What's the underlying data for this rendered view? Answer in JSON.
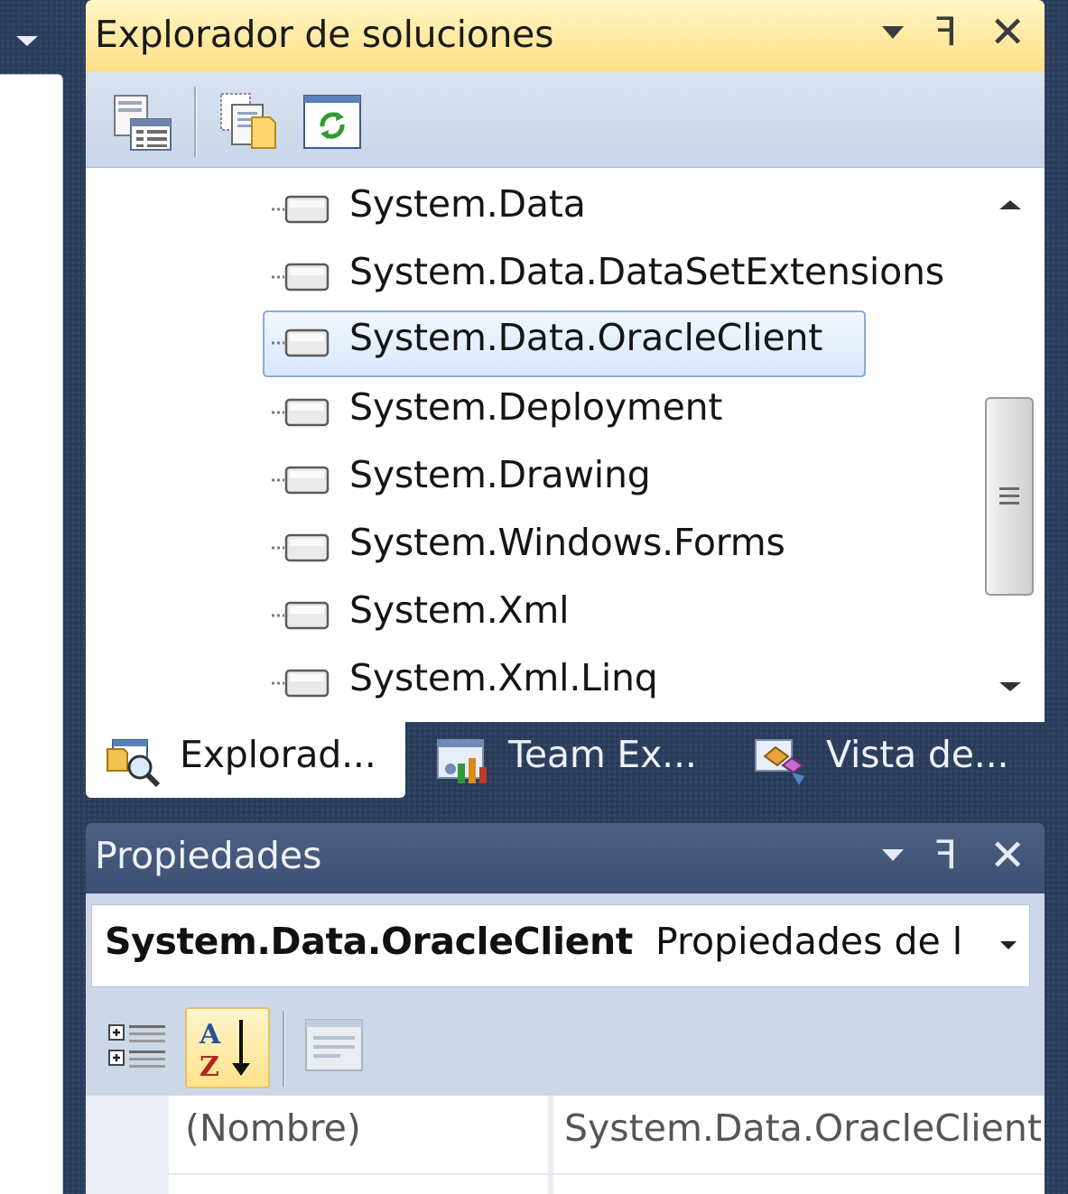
{
  "solution_explorer": {
    "title": "Explorador de soluciones",
    "controls": {
      "dropdown": "▾",
      "pin": "ꟻ",
      "close": "✕"
    },
    "toolbar": [
      {
        "name": "properties-icon"
      },
      {
        "name": "show-all-files-icon"
      },
      {
        "name": "refresh-icon"
      }
    ],
    "references": [
      {
        "label": "System.Data",
        "selected": false
      },
      {
        "label": "System.Data.DataSetExtensions",
        "selected": false
      },
      {
        "label": "System.Data.OracleClient",
        "selected": true
      },
      {
        "label": "System.Deployment",
        "selected": false
      },
      {
        "label": "System.Drawing",
        "selected": false
      },
      {
        "label": "System.Windows.Forms",
        "selected": false
      },
      {
        "label": "System.Xml",
        "selected": false
      },
      {
        "label": "System.Xml.Linq",
        "selected": false
      }
    ],
    "tabs": [
      {
        "label": "Explorad...",
        "icon": "solution-explorer-icon",
        "active": true
      },
      {
        "label": "Team Ex...",
        "icon": "team-explorer-icon",
        "active": false
      },
      {
        "label": "Vista de...",
        "icon": "class-view-icon",
        "active": false
      }
    ]
  },
  "properties": {
    "title": "Propiedades",
    "controls": {
      "pin": "ꟻ",
      "close": "✕"
    },
    "object_name": "System.Data.OracleClient",
    "object_type": "Propiedades de l",
    "grid": [
      {
        "name": "(Nombre)",
        "value": "System.Data.OracleClient"
      }
    ]
  },
  "colors": {
    "title_active": "#ffe9a1",
    "title_inactive": "#44587b",
    "selection_border": "#84acdd",
    "frame": "#2c3e5d"
  }
}
